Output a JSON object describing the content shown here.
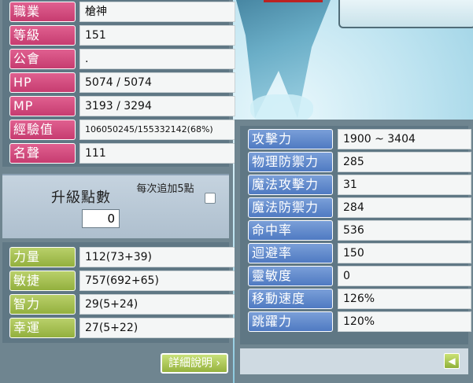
{
  "char_info": [
    {
      "label": "職業",
      "value": "槍神"
    },
    {
      "label": "等級",
      "value": "151"
    },
    {
      "label": "公會",
      "value": "."
    },
    {
      "label": "HP",
      "value": "5074 / 5074"
    },
    {
      "label": "MP",
      "value": "3193 / 3294"
    },
    {
      "label": "經驗值",
      "value": "106050245/155332142(68%)"
    },
    {
      "label": "名聲",
      "value": "111"
    }
  ],
  "upgrade": {
    "title": "升級點數",
    "points": "0",
    "auto_label": "每次追加5點"
  },
  "base_stats": [
    {
      "label": "力量",
      "value": "112(73+39)"
    },
    {
      "label": "敏捷",
      "value": "757(692+65)"
    },
    {
      "label": "智力",
      "value": "29(5+24)"
    },
    {
      "label": "幸運",
      "value": "27(5+22)"
    }
  ],
  "detail_button": "詳細說明",
  "detail_stats": [
    {
      "label": "攻擊力",
      "value": "1900 ~ 3404"
    },
    {
      "label": "物理防禦力",
      "value": "285"
    },
    {
      "label": "魔法攻擊力",
      "value": "31"
    },
    {
      "label": "魔法防禦力",
      "value": "284"
    },
    {
      "label": "命中率",
      "value": "536"
    },
    {
      "label": "迴避率",
      "value": "150"
    },
    {
      "label": "靈敏度",
      "value": "0"
    },
    {
      "label": "移動速度",
      "value": "126%"
    },
    {
      "label": "跳躍力",
      "value": "120%"
    }
  ],
  "colors": {
    "pink_label": "#d04c7c",
    "green_label": "#a3bd4f",
    "blue_label": "#5c86cc",
    "panel": "#5f7784"
  }
}
